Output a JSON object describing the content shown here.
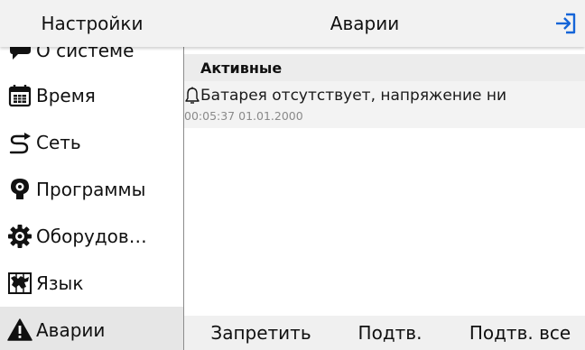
{
  "header": {
    "left_title": "Настройки",
    "title": "Аварии",
    "exit_icon": "exit-icon",
    "accent_color": "#1565d8"
  },
  "sidebar": {
    "items": [
      {
        "label": "О системе",
        "icon": "chat-bubble-icon"
      },
      {
        "label": "Время",
        "icon": "calendar-icon"
      },
      {
        "label": "Сеть",
        "icon": "network-route-icon"
      },
      {
        "label": "Программы",
        "icon": "app-icon"
      },
      {
        "label": "Оборудов…",
        "icon": "gear-icon"
      },
      {
        "label": "Язык",
        "icon": "map-icon"
      },
      {
        "label": "Аварии",
        "icon": "warning-icon"
      }
    ],
    "active_index": 6
  },
  "main": {
    "section_title": "Активные",
    "alarms": [
      {
        "icon": "bell-icon",
        "message": "Батарея отсутствует, напряжение ни",
        "timestamp": "00:05:37 01.01.2000"
      }
    ]
  },
  "actions": {
    "disable_label": "Запретить",
    "ack_label": "Подтв.",
    "ack_all_label": "Подтв. все"
  }
}
